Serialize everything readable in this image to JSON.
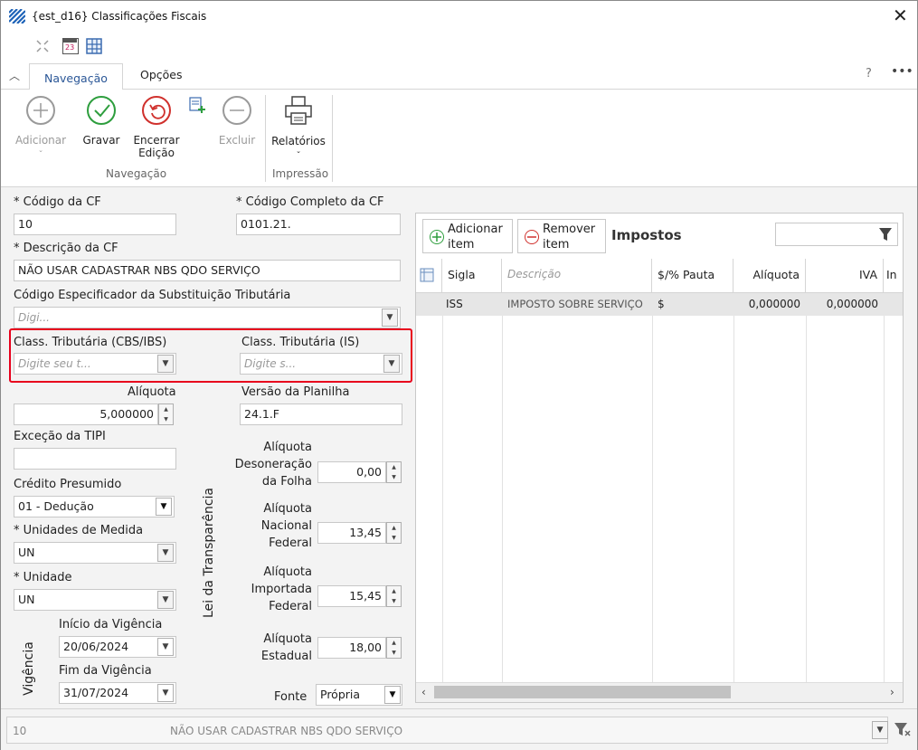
{
  "window": {
    "title": "{est_d16}  Classificações Fiscais"
  },
  "tabs": {
    "navegacao": "Navegação",
    "opcoes": "Opções"
  },
  "ribbon": {
    "adicionar": "Adicionar",
    "gravar": "Gravar",
    "encerrar1": "Encerrar",
    "encerrar2": "Edição",
    "excluir": "Excluir",
    "relatorios": "Relatórios",
    "group_navegacao": "Navegação",
    "group_impressao": "Impressão",
    "calendar_day": "23"
  },
  "form": {
    "codigo_cf_label": "* Código da CF",
    "codigo_cf_value": "10",
    "codigo_completo_label": "* Código Completo da CF",
    "codigo_completo_value": "0101.21.",
    "descricao_label": "* Descrição da CF",
    "descricao_value": "NÃO USAR CADASTRAR NBS QDO SERVIÇO",
    "cest_label": "Código Especificador da Substituição  Tributária",
    "cest_placeholder": "Digi...",
    "cbs_label": "Class. Tributária (CBS/IBS)",
    "cbs_placeholder": "Digite seu t...",
    "is_label": "Class. Tributária (IS)",
    "is_placeholder": "Digite s...",
    "aliquota_label": "Alíquota",
    "aliquota_value": "5,000000",
    "versao_label": "Versão da Planilha",
    "versao_value": "24.1.F",
    "excecao_label": "Exceção da TIPI",
    "credito_label": "Crédito Presumido",
    "credito_value": "01 - Dedução",
    "unidades_label": "* Unidades de Medida",
    "unidades_value": "UN",
    "unidade_label": "* Unidade",
    "unidade_value": "UN",
    "vigencia_label": "Vigência",
    "inicio_label": "Início da Vigência",
    "inicio_value": "20/06/2024",
    "fim_label": "Fim da Vigência",
    "fim_value": "31/07/2024",
    "transparencia_label": "Lei da Transparência",
    "deson_l1": "Alíquota",
    "deson_l2": "Desoneração",
    "deson_l3": "da Folha",
    "deson_value": "0,00",
    "nac_l1": "Alíquota",
    "nac_l2": "Nacional",
    "nac_l3": "Federal",
    "nac_value": "13,45",
    "imp_l1": "Alíquota",
    "imp_l2": "Importada",
    "imp_l3": "Federal",
    "imp_value": "15,45",
    "est_l1": "Alíquota",
    "est_l2": "Estadual",
    "est_value": "18,00",
    "fonte_label": "Fonte",
    "fonte_value": "Própria"
  },
  "impostos": {
    "add1": "Adicionar",
    "add2": "item",
    "rem1": "Remover",
    "rem2": "item",
    "title": "Impostos",
    "columns": [
      "Sigla",
      "Descrição",
      "$/% Pauta",
      "Alíquota",
      "IVA",
      "In"
    ],
    "row": {
      "sigla": "ISS",
      "descricao": "IMPOSTO SOBRE SERVIÇO",
      "pauta": "$",
      "aliquota": "0,000000",
      "iva": "0,000000"
    }
  },
  "footer": {
    "code": "10",
    "description": "NÃO USAR CADASTRAR NBS QDO SERVIÇO"
  },
  "colors": {
    "accent": "#2b5797",
    "highlight": "#e8001c",
    "green": "#2e9e3e",
    "red": "#d0312d"
  }
}
